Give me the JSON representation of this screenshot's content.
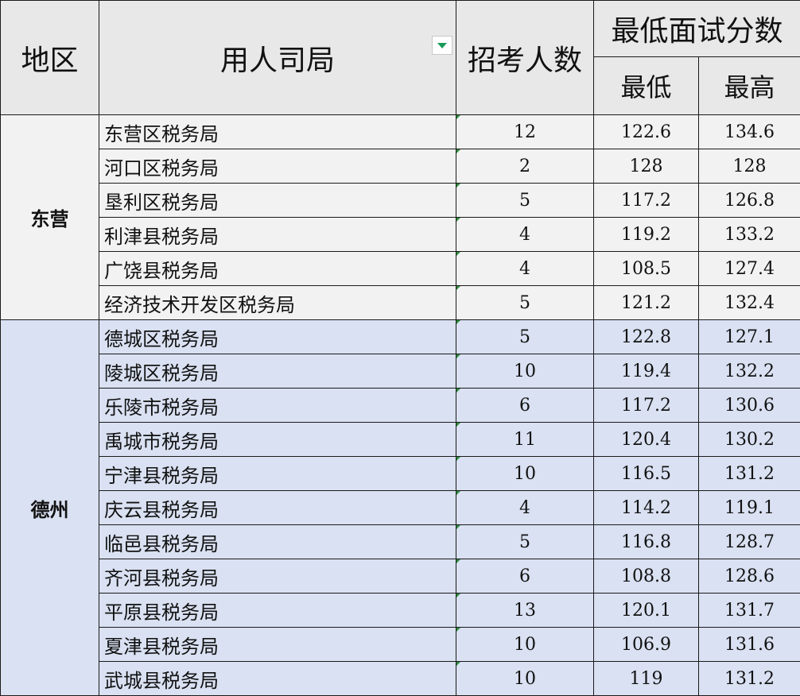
{
  "header": {
    "region": "地区",
    "agency": "用人司局",
    "recruits": "招考人数",
    "score_group": "最低面试分数",
    "min": "最低",
    "max": "最高"
  },
  "icons": {
    "filter": "filter-dropdown-icon",
    "filter_color": "#1a9a58"
  },
  "colors": {
    "header_bg": "#e8e8e8",
    "group_dongying": "#f2f2f2",
    "group_dezhou": "#d9e1f2"
  },
  "groups": [
    {
      "region": "东营",
      "rows": [
        {
          "agency": "东营区税务局",
          "recruits": "12",
          "min": "122.6",
          "max": "134.6"
        },
        {
          "agency": "河口区税务局",
          "recruits": "2",
          "min": "128",
          "max": "128"
        },
        {
          "agency": "垦利区税务局",
          "recruits": "5",
          "min": "117.2",
          "max": "126.8"
        },
        {
          "agency": "利津县税务局",
          "recruits": "4",
          "min": "119.2",
          "max": "133.2"
        },
        {
          "agency": "广饶县税务局",
          "recruits": "4",
          "min": "108.5",
          "max": "127.4"
        },
        {
          "agency": "经济技术开发区税务局",
          "recruits": "5",
          "min": "121.2",
          "max": "132.4"
        }
      ]
    },
    {
      "region": "德州",
      "rows": [
        {
          "agency": "德城区税务局",
          "recruits": "5",
          "min": "122.8",
          "max": "127.1"
        },
        {
          "agency": "陵城区税务局",
          "recruits": "10",
          "min": "119.4",
          "max": "132.2"
        },
        {
          "agency": "乐陵市税务局",
          "recruits": "6",
          "min": "117.2",
          "max": "130.6"
        },
        {
          "agency": "禹城市税务局",
          "recruits": "11",
          "min": "120.4",
          "max": "130.2"
        },
        {
          "agency": "宁津县税务局",
          "recruits": "10",
          "min": "116.5",
          "max": "131.2"
        },
        {
          "agency": "庆云县税务局",
          "recruits": "4",
          "min": "114.2",
          "max": "119.1"
        },
        {
          "agency": "临邑县税务局",
          "recruits": "5",
          "min": "116.8",
          "max": "128.7"
        },
        {
          "agency": "齐河县税务局",
          "recruits": "6",
          "min": "108.8",
          "max": "128.6"
        },
        {
          "agency": "平原县税务局",
          "recruits": "13",
          "min": "120.1",
          "max": "131.7"
        },
        {
          "agency": "夏津县税务局",
          "recruits": "10",
          "min": "106.9",
          "max": "131.6"
        },
        {
          "agency": "武城县税务局",
          "recruits": "10",
          "min": "119",
          "max": "131.2"
        }
      ]
    }
  ]
}
